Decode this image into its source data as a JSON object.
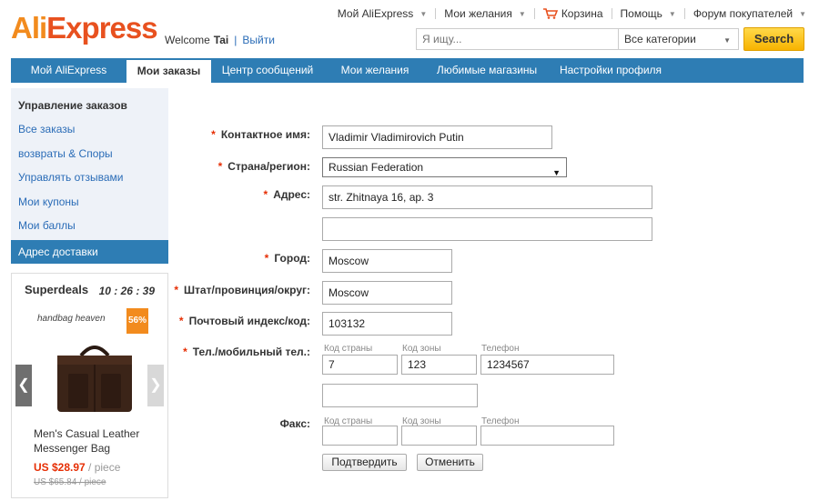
{
  "brand": {
    "logo_part1": "Ali",
    "logo_part2": "Express"
  },
  "welcome": {
    "greeting": "Welcome",
    "user": "Tai",
    "separator": "|",
    "logout": "Выйти"
  },
  "topnav": {
    "my_aliexpress": "Мой AliExpress",
    "wishlist": "Мои желания",
    "cart": "Корзина",
    "help": "Помощь",
    "forum": "Форум покупателей"
  },
  "search": {
    "placeholder": "Я ищу...",
    "category": "Все категории",
    "button": "Search"
  },
  "mainnav": {
    "tabs": [
      {
        "label": "Мой AliExpress"
      },
      {
        "label": "Мои заказы"
      },
      {
        "label": "Центр сообщений"
      },
      {
        "label": "Мои желания"
      },
      {
        "label": "Любимые магазины"
      },
      {
        "label": "Настройки профиля"
      }
    ]
  },
  "sidebar": {
    "heading": "Управление заказов",
    "items": [
      {
        "label": "Все заказы"
      },
      {
        "label": "возвраты & Споры"
      },
      {
        "label": "Управлять отзывами"
      },
      {
        "label": "Мои купоны"
      },
      {
        "label": "Мои баллы"
      },
      {
        "label": "Адрес доставки"
      }
    ]
  },
  "superdeals": {
    "title": "Superdeals",
    "timer": "10 : 26 : 39",
    "brand": "handbag heaven",
    "discount": "56%",
    "product_name": "Men's Casual Leather Messenger Bag",
    "price": "US $28.97",
    "price_unit": " / piece",
    "old_price": "US $65.84 / piece"
  },
  "form": {
    "contact_name": {
      "label": "Контактное имя:",
      "value": "Vladimir Vladimirovich Putin"
    },
    "country": {
      "label": "Страна/регион:",
      "value": "Russian Federation"
    },
    "address": {
      "label": "Адрес:",
      "value": "str. Zhitnaya 16, ap. 3",
      "value2": ""
    },
    "city": {
      "label": "Город:",
      "value": "Moscow"
    },
    "state": {
      "label": "Штат/провинция/округ:",
      "value": "Moscow"
    },
    "zip": {
      "label": "Почтовый индекс/код:",
      "value": "103132"
    },
    "phone": {
      "label": "Тел./мобильный тел.:",
      "country_code_label": "Код страны",
      "area_code_label": "Код зоны",
      "number_label": "Телефон",
      "country_code": "7",
      "area_code": "123",
      "number": "1234567",
      "mobile": ""
    },
    "fax": {
      "label": "Факс:",
      "country_code_label": "Код страны",
      "area_code_label": "Код зоны",
      "number_label": "Телефон",
      "country_code": "",
      "area_code": "",
      "number": ""
    },
    "star": "*",
    "confirm_button": "Подтвердить",
    "cancel_button": "Отменить"
  },
  "colors": {
    "nav_blue": "#2e7db4",
    "accent_orange": "#e8511f",
    "search_yellow": "#f7b300",
    "required_red": "#e62e04"
  }
}
